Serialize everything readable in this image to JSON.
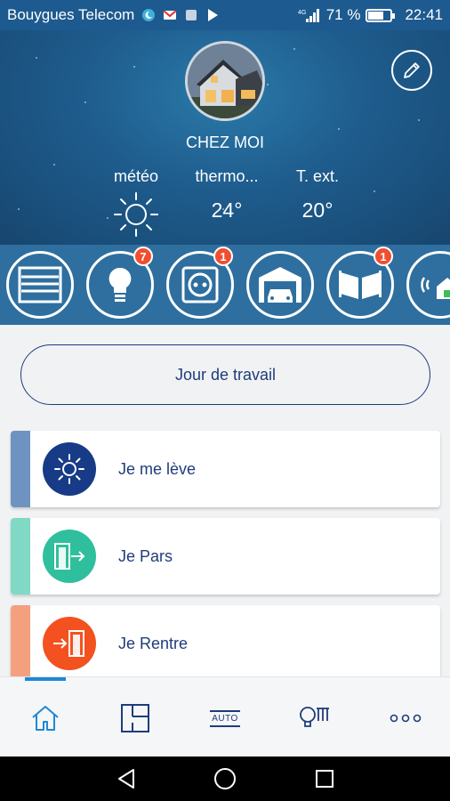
{
  "status_bar": {
    "carrier": "Bouygues Telecom",
    "battery": "71 %",
    "battery_level": 0.71,
    "time": "22:41"
  },
  "header": {
    "title": "CHEZ MOI",
    "stats": [
      {
        "label": "météo",
        "value": ""
      },
      {
        "label": "thermo...",
        "value": "24°"
      },
      {
        "label": "T. ext.",
        "value": "20°"
      }
    ]
  },
  "devices": [
    {
      "icon": "shutter-icon",
      "badge": ""
    },
    {
      "icon": "bulb-icon",
      "badge": "7"
    },
    {
      "icon": "plug-icon",
      "badge": "1"
    },
    {
      "icon": "garage-icon",
      "badge": ""
    },
    {
      "icon": "gate-icon",
      "badge": "1"
    },
    {
      "icon": "home-connect-icon",
      "badge": ""
    }
  ],
  "scenario_label": "Jour de travail",
  "cards": [
    {
      "label": "Je me lève",
      "icon": "sun-icon",
      "accent": "#6f93c0",
      "icon_bg": "#173b86"
    },
    {
      "label": "Je Pars",
      "icon": "door-exit-icon",
      "accent": "#7fd9c4",
      "icon_bg": "#2fbf9c"
    },
    {
      "label": "Je Rentre",
      "icon": "door-enter-icon",
      "accent": "#f4a07f",
      "icon_bg": "#f3511f"
    }
  ],
  "bottom_nav": [
    {
      "name": "home",
      "icon": "home-icon",
      "label": ""
    },
    {
      "name": "floorplan",
      "icon": "floorplan-icon",
      "label": ""
    },
    {
      "name": "auto",
      "icon": "auto-icon",
      "label": "AUTO"
    },
    {
      "name": "lighting",
      "icon": "lamp-icon",
      "label": ""
    },
    {
      "name": "more",
      "icon": "more-icon",
      "label": ""
    }
  ],
  "colors": {
    "brand_blue": "#1e3c7b",
    "header_blue": "#1e5c8d",
    "nav_active": "#1e88d6",
    "badge_red": "#f04e30"
  }
}
